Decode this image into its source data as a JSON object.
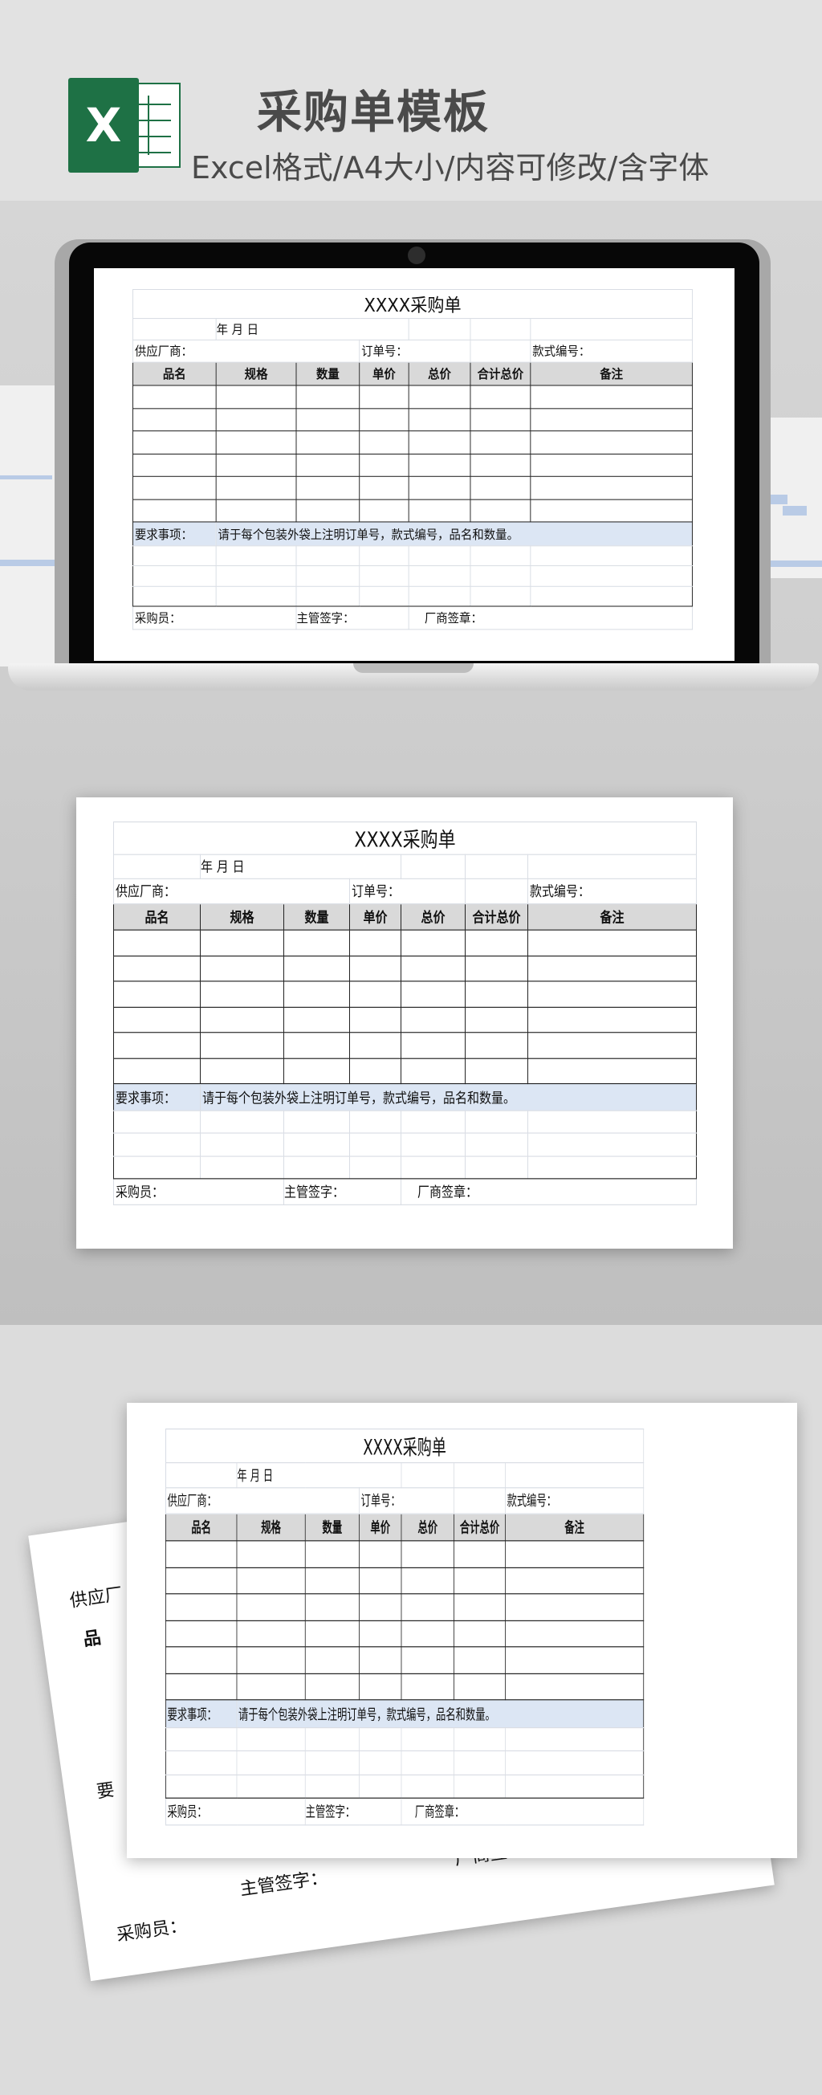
{
  "header": {
    "title": "采购单模板",
    "subtitle": "Excel格式/A4大小/内容可修改/含字体",
    "excel_icon_letter": "X"
  },
  "form": {
    "title": "XXXX采购单",
    "date_line": "年    月    日",
    "supplier_label": "供应厂商：",
    "order_no_label": "订单号：",
    "style_no_label": "款式编号：",
    "columns": [
      "品名",
      "规格",
      "数量",
      "单价",
      "总价",
      "合计总价",
      "备注"
    ],
    "requirements_label": "要求事项：",
    "requirements_text": "请于每个包装外袋上注明订单号，款式编号，品名和数量。",
    "purchaser_label": "采购员：",
    "supervisor_label": "主管签字：",
    "vendor_seal_label": "厂商签章："
  },
  "back_paper": {
    "supplier_label": "供应厂",
    "col_first": "品",
    "req_label": "要",
    "supervisor_label": "主管签字：",
    "vendor_seal_label": "厂商签章：",
    "purchaser_label": "采购员："
  },
  "colors": {
    "excel_green": "#1e7145",
    "header_fill": "#d9d9d9",
    "note_fill": "#dce6f4",
    "title_gray": "#4a4a4a"
  }
}
